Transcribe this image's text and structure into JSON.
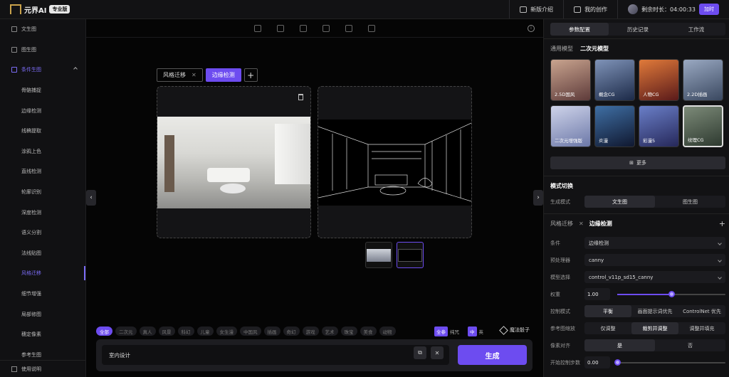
{
  "topbar": {
    "logo_text": "元界AI",
    "edition": "专业版",
    "new_intro": "新版介绍",
    "my_works": "我的创作",
    "time_left": "剩余时长：04:00:33",
    "add_time": "加时"
  },
  "sidebar": {
    "items": [
      {
        "label": "文生图",
        "type": "top"
      },
      {
        "label": "图生图",
        "type": "top"
      },
      {
        "label": "条件生图",
        "type": "parent"
      },
      {
        "label": "骨骼捕捉"
      },
      {
        "label": "边缘检测"
      },
      {
        "label": "线稿提取"
      },
      {
        "label": "涂鸦上色"
      },
      {
        "label": "直线检测"
      },
      {
        "label": "轮廓识别"
      },
      {
        "label": "深度检测"
      },
      {
        "label": "语义分割"
      },
      {
        "label": "法线贴图"
      },
      {
        "label": "风格迁移",
        "selected": true
      },
      {
        "label": "细节增强"
      },
      {
        "label": "局部修图"
      },
      {
        "label": "穗定像素"
      },
      {
        "label": "参考生图"
      }
    ],
    "help": "使用说明"
  },
  "canvas": {
    "tabs": [
      {
        "label": "风格迁移",
        "closable": true
      },
      {
        "label": "边缘检测",
        "active": true
      }
    ],
    "add_tab": "+"
  },
  "tags": {
    "items": [
      "全部",
      "二次元",
      "真人",
      "风景",
      "科幻",
      "儿童",
      "女生漫",
      "中国风",
      "插画",
      "奇幻",
      "游戏",
      "艺术",
      "珠宝",
      "美食",
      "动物"
    ],
    "active_index": 0,
    "mode_full": "全参",
    "mode_pure": "纯咒",
    "lang_cn": "中",
    "lang_en": "英",
    "magic_dice": "魔法骰子"
  },
  "prompt": {
    "value": "室内设计",
    "generate": "生成"
  },
  "right": {
    "tabs": [
      "参数配置",
      "历史记录",
      "工作流"
    ],
    "active_tab": 0,
    "model_type_general": "通用模型",
    "model_type_anime": "二次元模型",
    "models": [
      {
        "label": "2.5D国风",
        "c1": "#c9a48f",
        "c2": "#5e3b3a"
      },
      {
        "label": "概念CG",
        "c1": "#7f93b8",
        "c2": "#1c2a48"
      },
      {
        "label": "人物CG",
        "c1": "#e07a3a",
        "c2": "#5a1a1a"
      },
      {
        "label": "2.2D插画",
        "c1": "#9aa9c2",
        "c2": "#3a4860"
      },
      {
        "label": "二次元增强版",
        "c1": "#cfd4ea",
        "c2": "#6c78a8"
      },
      {
        "label": "炎漫",
        "c1": "#3f6fa4",
        "c2": "#101830"
      },
      {
        "label": "彩漫5",
        "c1": "#6a7fc8",
        "c2": "#26285a"
      },
      {
        "label": "纹理CG",
        "c1": "#7c8a78",
        "c2": "#2e3a30",
        "selected": true
      }
    ],
    "more": "更多",
    "mode_switch_title": "模式切换",
    "gen_mode_label": "生成模式",
    "gen_modes": [
      "文生图",
      "图生图"
    ],
    "gen_mode_active": 0,
    "cond_tab_1": "风格迁移",
    "cond_tab_2": "边缘检测",
    "cond_label": "条件",
    "cond_value": "边缘检测",
    "preproc_label": "预处理器",
    "preproc_value": "canny",
    "model_label": "模型选择",
    "model_value": "control_v11p_sd15_canny",
    "weight_label": "权重",
    "weight_value": "1.00",
    "weight_fraction": 0.5,
    "control_mode_label": "控制模式",
    "control_modes": [
      "平衡",
      "画面提示词优先",
      "ControlNet 优先"
    ],
    "control_mode_active": 0,
    "resize_label": "参考图缩放",
    "resize_modes": [
      "仅调整",
      "裁剪并调整",
      "调整并填充"
    ],
    "resize_active": 1,
    "pixel_label": "像素对齐",
    "pixel_modes": [
      "是",
      "否"
    ],
    "pixel_active": 0,
    "start_label": "开始控制步数",
    "start_value": "0.00",
    "start_fraction": 0.0
  }
}
